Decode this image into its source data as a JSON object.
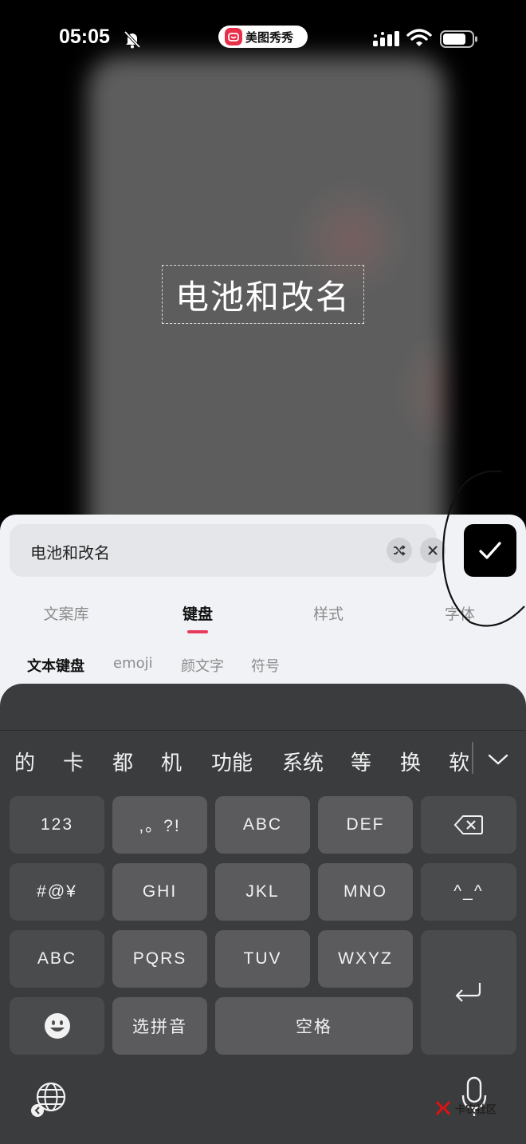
{
  "status_bar": {
    "time": "05:05",
    "app_name": "美图秀秀"
  },
  "canvas": {
    "text": "电池和改名"
  },
  "editor": {
    "input_value": "电池和改名"
  },
  "tabs": [
    {
      "label": "文案库"
    },
    {
      "label": "键盘"
    },
    {
      "label": "样式"
    },
    {
      "label": "字体"
    }
  ],
  "sub_tabs": [
    {
      "label": "文本键盘"
    },
    {
      "label": "emoji"
    },
    {
      "label": "颜文字"
    },
    {
      "label": "符号"
    }
  ],
  "keyboard": {
    "candidates": [
      "的",
      "卡",
      "都",
      "机",
      "功能",
      "系统",
      "等",
      "换",
      "软"
    ],
    "keys": {
      "k123": "123",
      "punct": ",。?!",
      "abc1": "ABC",
      "def": "DEF",
      "symbols": "#@¥",
      "ghi": "GHI",
      "jkl": "JKL",
      "mno": "MNO",
      "kaomoji": "^_^",
      "abc2": "ABC",
      "pqrs": "PQRS",
      "tuv": "TUV",
      "wxyz": "WXYZ",
      "pinyin": "选拼音",
      "space": "空格"
    }
  },
  "watermark": "卡农社区",
  "colors": {
    "accent": "#e83a5b",
    "keyboard_bg": "#3b3c3e",
    "key_bg": "#5b5b5e",
    "panel_bg": "#f0f2f5"
  }
}
